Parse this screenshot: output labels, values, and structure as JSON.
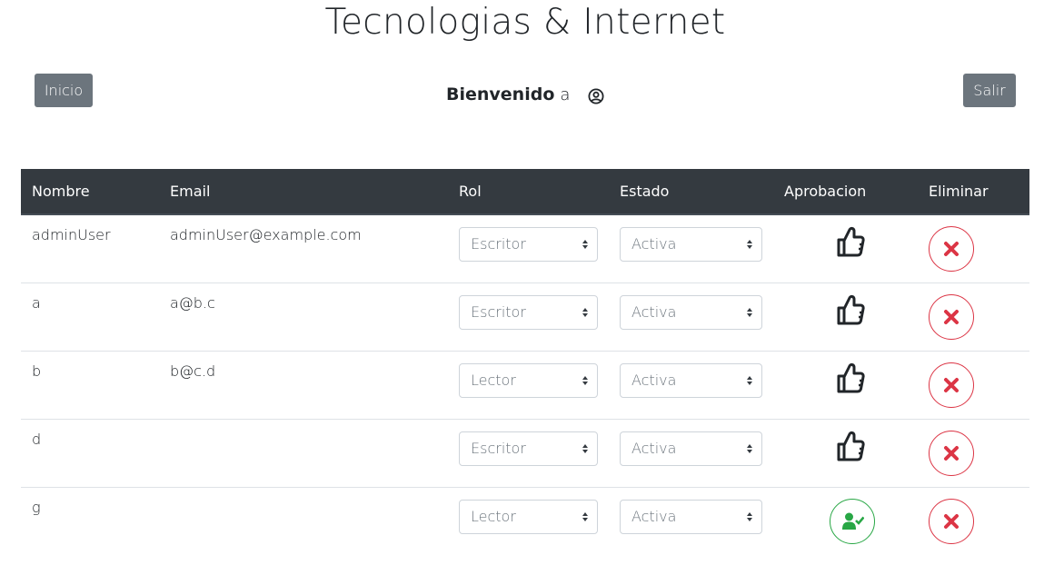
{
  "header": {
    "title": "Tecnologias & Internet",
    "home_label": "Inicio",
    "logout_label": "Salir",
    "welcome_label": "Bienvenido",
    "username": "a",
    "user_icon": "user-circle-icon"
  },
  "table": {
    "columns": [
      "Nombre",
      "Email",
      "Rol",
      "Estado",
      "Aprobacion",
      "Eliminar"
    ],
    "rows": [
      {
        "nombre": "adminUser",
        "email": "adminUser@example.com",
        "rol": "Escritor",
        "estado": "Activa",
        "aprobacion": "thumbs-up-icon"
      },
      {
        "nombre": "a",
        "email": "a@b.c",
        "rol": "Escritor",
        "estado": "Activa",
        "aprobacion": "thumbs-up-icon"
      },
      {
        "nombre": "b",
        "email": "b@c.d",
        "rol": "Lector",
        "estado": "Activa",
        "aprobacion": "thumbs-up-icon"
      },
      {
        "nombre": "d",
        "email": "",
        "rol": "Escritor",
        "estado": "Activa",
        "aprobacion": "thumbs-up-icon"
      },
      {
        "nombre": "g",
        "email": "",
        "rol": "Lector",
        "estado": "Activa",
        "aprobacion": "user-check-icon"
      }
    ],
    "delete_icon": "close-icon"
  },
  "colors": {
    "header_bg": "#343a40",
    "button_gray": "#6c757d",
    "danger": "#dc3545",
    "success": "#28a745"
  }
}
